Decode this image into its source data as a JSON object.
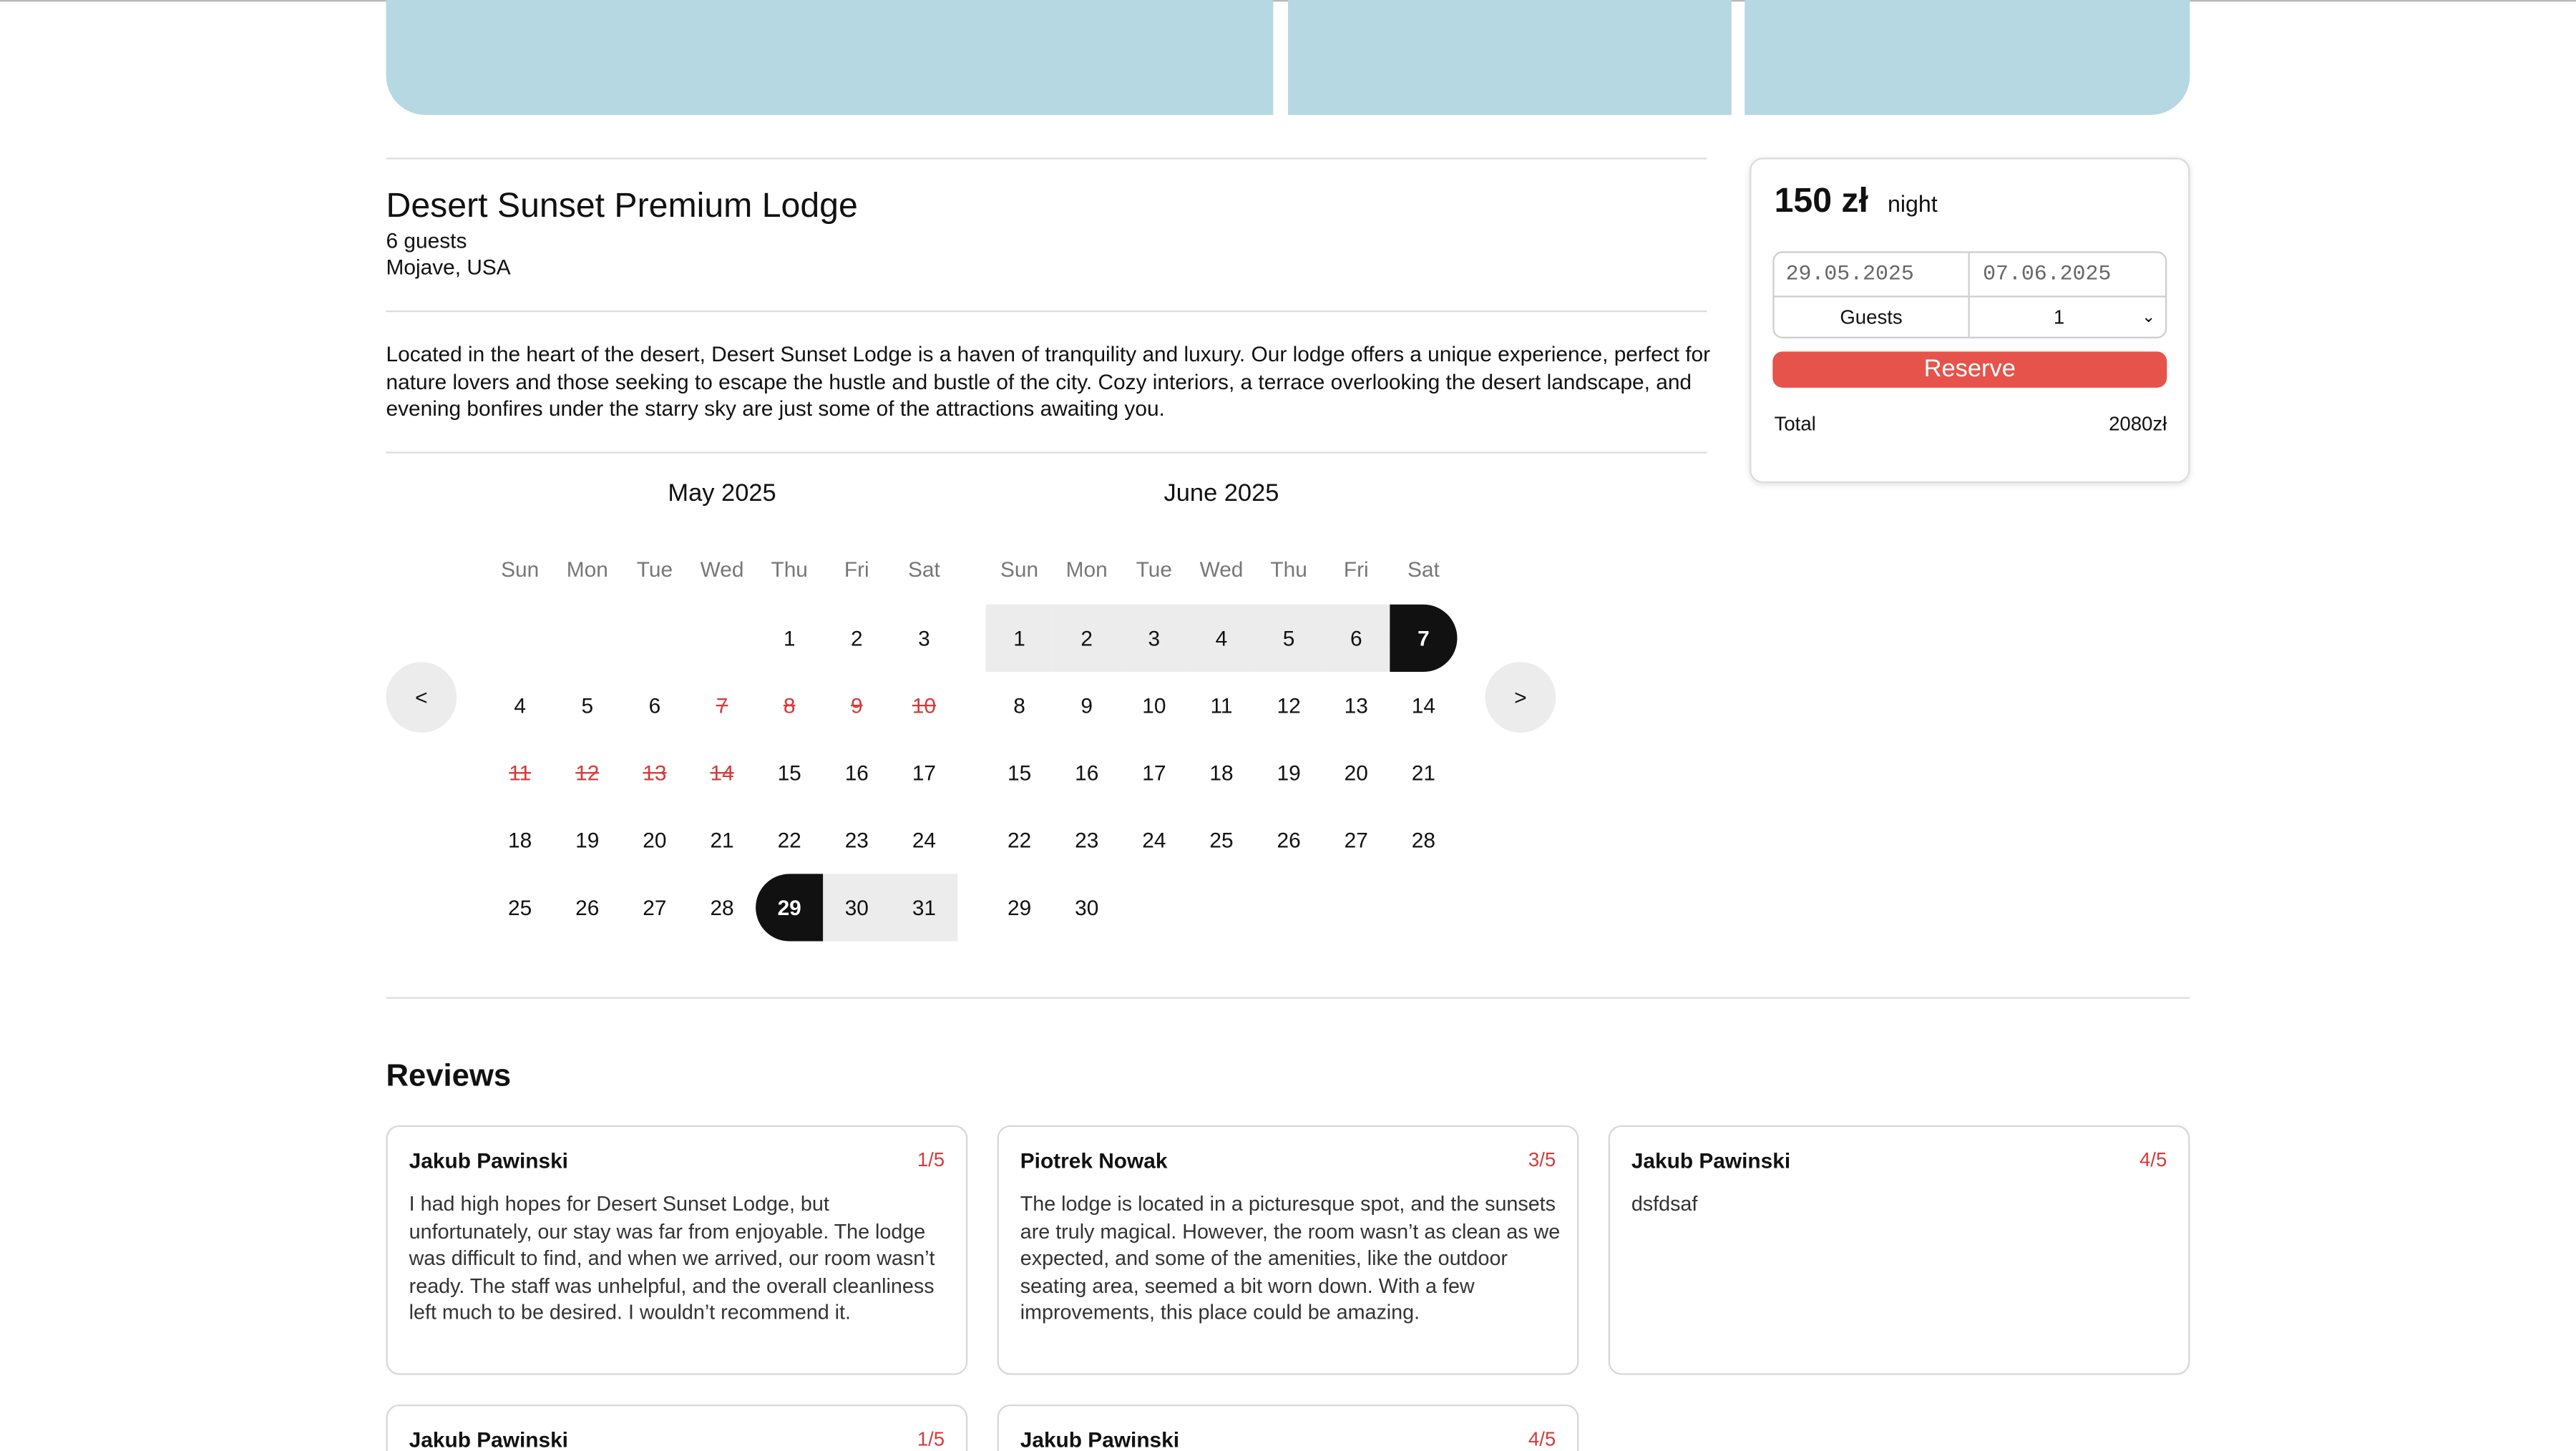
{
  "listing": {
    "title": "Desert Sunset Premium Lodge",
    "guests": "6 guests",
    "location": "Mojave, USA",
    "description": "Located in the heart of the desert, Desert Sunset Lodge is a haven of tranquility and luxury. Our lodge offers a unique experience, perfect for nature lovers and those seeking to escape the hustle and bustle of the city. Cozy interiors, a terrace overlooking the desert landscape, and evening bonfires under the starry sky are just some of the attractions awaiting you."
  },
  "calendar": {
    "prev_label": "<",
    "next_label": ">",
    "weekdays": [
      "Sun",
      "Mon",
      "Tue",
      "Wed",
      "Thu",
      "Fri",
      "Sat"
    ],
    "months": [
      {
        "title": "May 2025",
        "first_weekday": 4,
        "days_in_month": 31,
        "disabled_days": [
          7,
          8,
          9,
          10,
          11,
          12,
          13,
          14
        ],
        "selected_start": 29,
        "range_days": [
          30,
          31
        ]
      },
      {
        "title": "June 2025",
        "first_weekday": 0,
        "days_in_month": 30,
        "disabled_days": [],
        "selected_end": 7,
        "range_days": [
          1,
          2,
          3,
          4,
          5,
          6
        ]
      }
    ]
  },
  "booking": {
    "price": "150 zł",
    "price_unit": "night",
    "check_in": "29.05.2025",
    "check_out": "07.06.2025",
    "guests_label": "Guests",
    "guests_value": "1",
    "reserve_label": "Reserve",
    "total_label": "Total",
    "total_value": "2080zł"
  },
  "reviews": {
    "title": "Reviews",
    "items": [
      {
        "author": "Jakub Pawinski",
        "rating": "1/5",
        "text": "I had high hopes for Desert Sunset Lodge, but unfortunately, our stay was far from enjoyable. The lodge was difficult to find, and when we arrived, our room wasn’t ready. The staff was unhelpful, and the overall cleanliness left much to be desired. I wouldn’t recommend it."
      },
      {
        "author": "Piotrek Nowak",
        "rating": "3/5",
        "text": "The lodge is located in a picturesque spot, and the sunsets are truly magical. However, the room wasn’t as clean as we expected, and some of the amenities, like the outdoor seating area, seemed a bit worn down. With a few improvements, this place could be amazing."
      },
      {
        "author": "Jakub Pawinski",
        "rating": "4/5",
        "text": "dsfdsaf"
      },
      {
        "author": "Jakub Pawinski",
        "rating": "1/5",
        "text": ""
      },
      {
        "author": "Jakub Pawinski",
        "rating": "4/5",
        "text": ""
      }
    ]
  },
  "colors": {
    "photo_placeholder": "#b6d8e3",
    "accent": "#e5534b",
    "disabled_day": "#d63a3a",
    "selected_day": "#111111",
    "range_day": "#ececec"
  }
}
